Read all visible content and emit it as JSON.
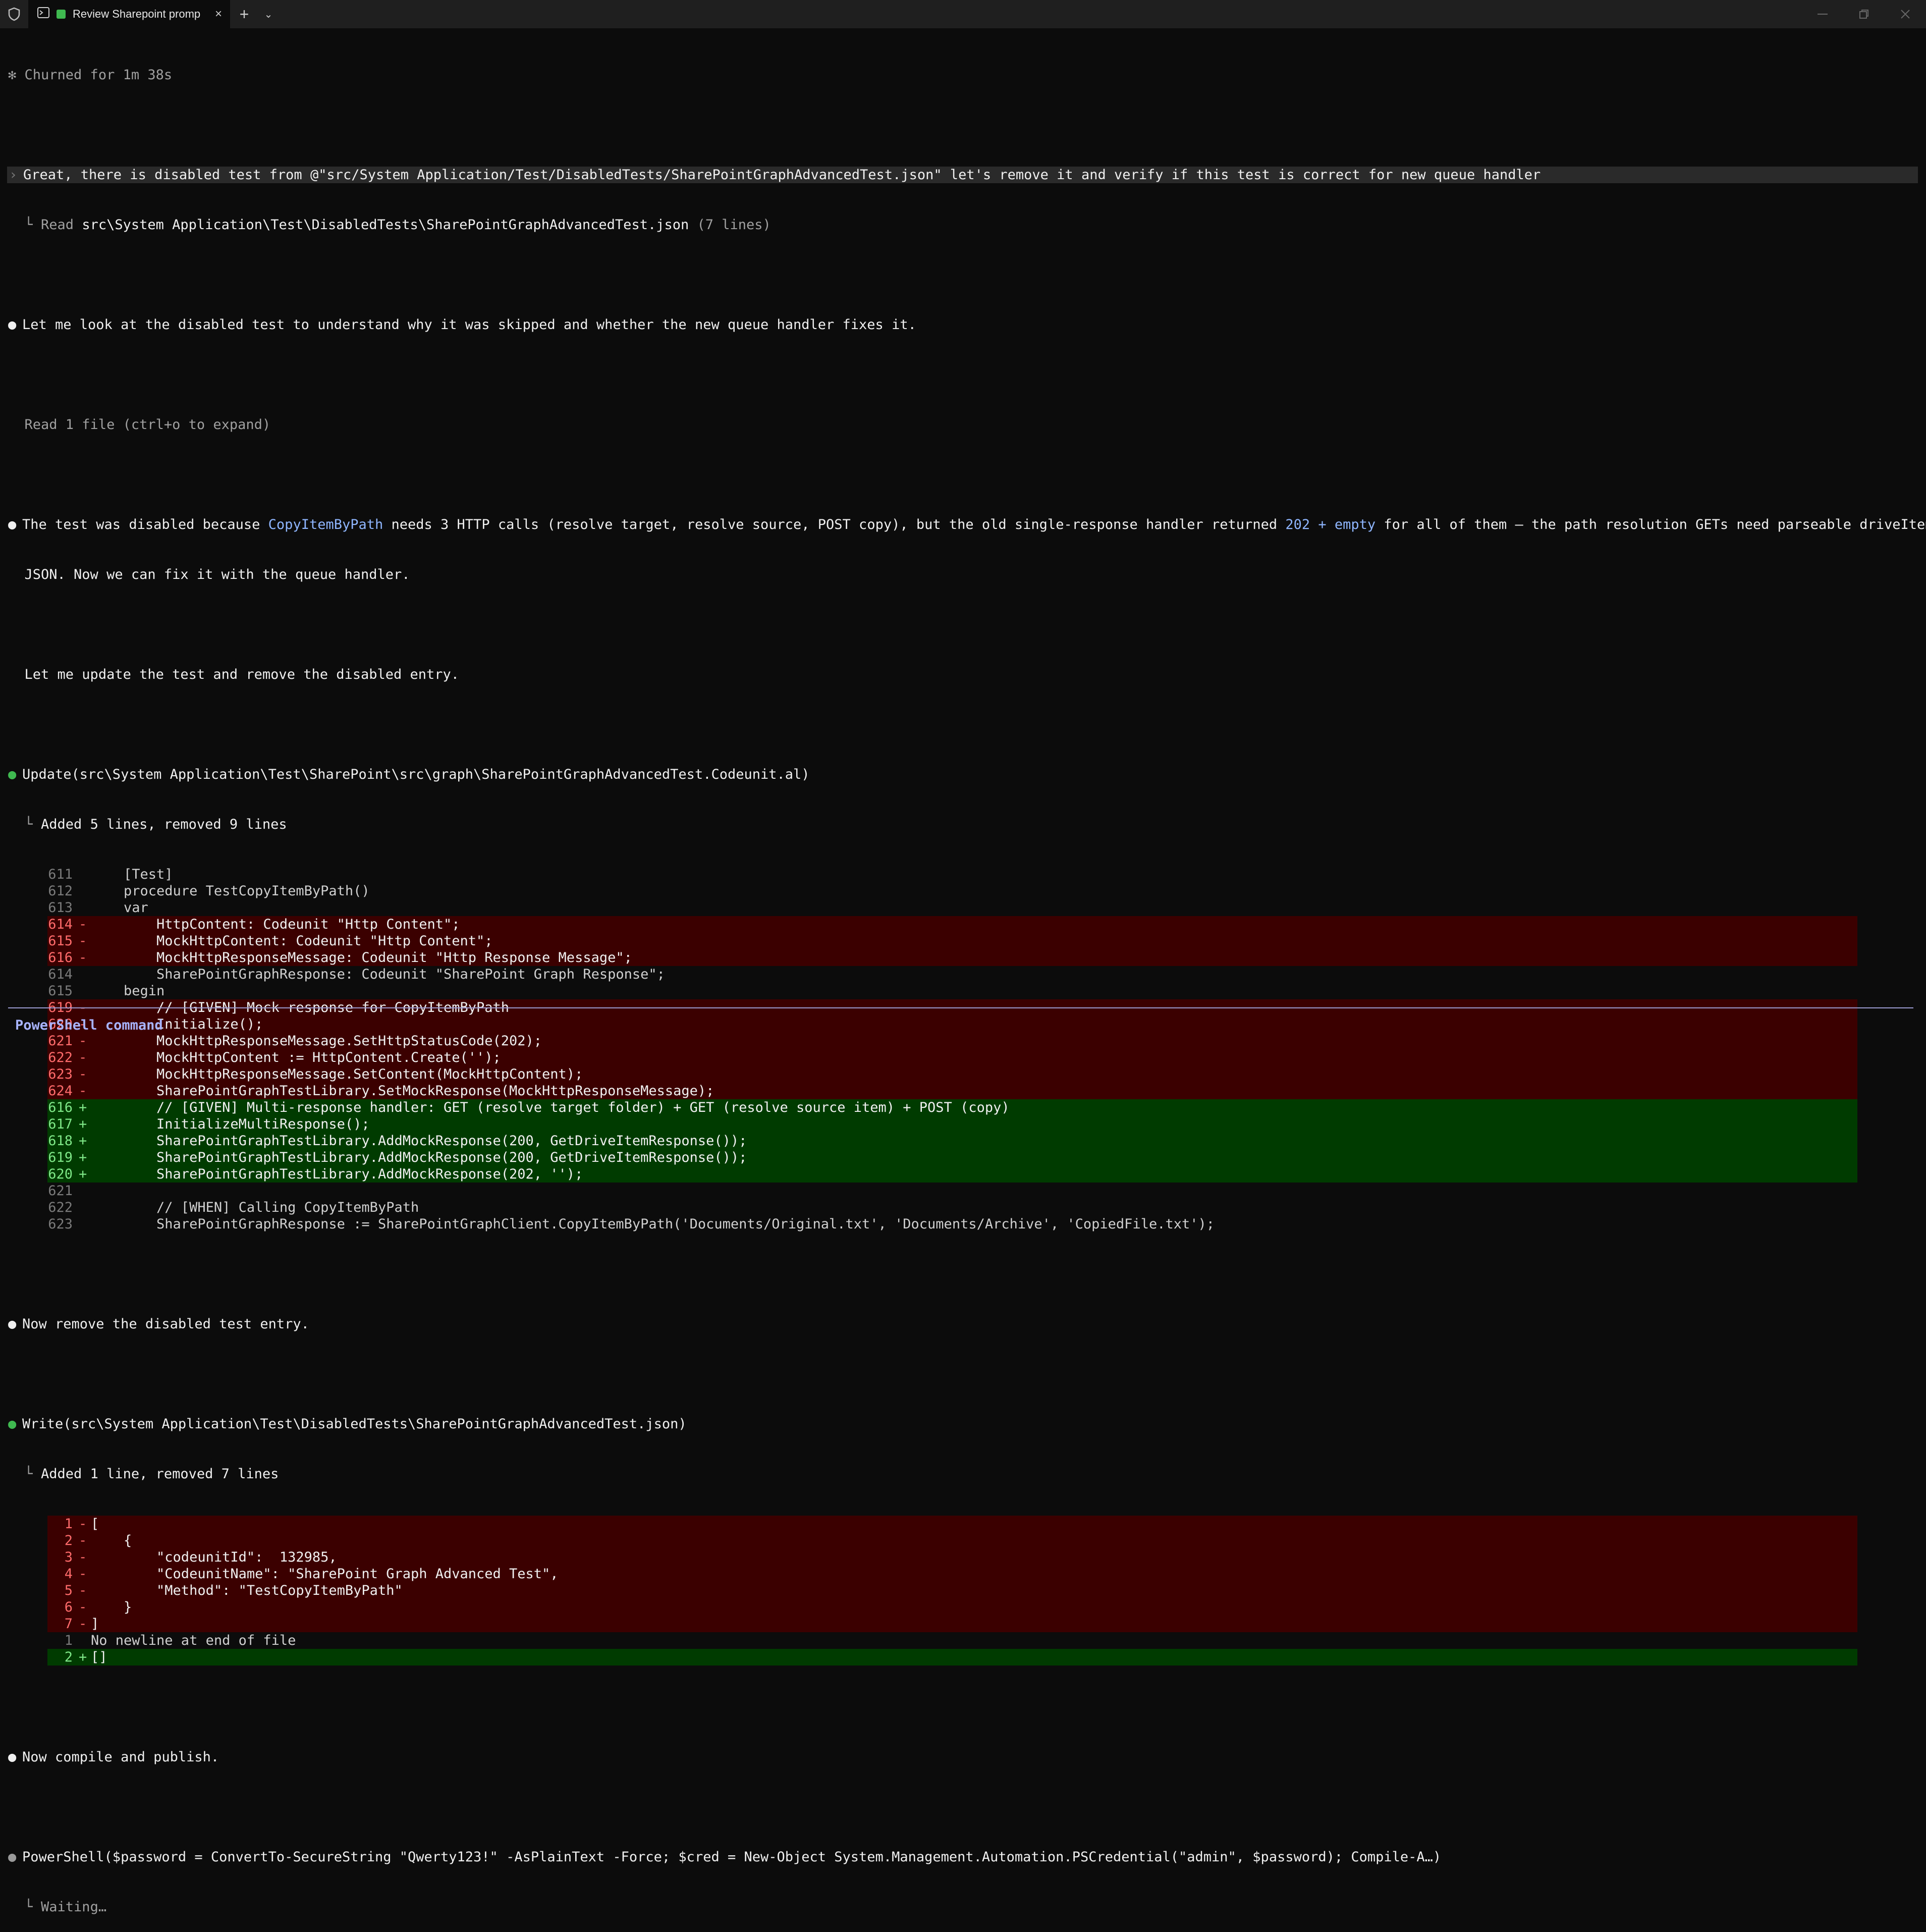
{
  "window": {
    "tab_title": "Review Sharepoint promp",
    "new_tab_symbol": "+",
    "dropdown_symbol": "⌄",
    "close_symbol": "×"
  },
  "status": {
    "churned": "Churned for 1m 38s"
  },
  "prompt": "Great, there is disabled test from @\"src/System Application/Test/DisabledTests/SharePointGraphAdvancedTest.json\" let's remove it and verify if this test is correct for new queue handler",
  "read_line": {
    "prefix": "Read",
    "path": "src\\System Application\\Test\\DisabledTests\\SharePointGraphAdvancedTest.json",
    "suffix": "(7 lines)"
  },
  "msg1": "Let me look at the disabled test to understand why it was skipped and whether the new queue handler fixes it.",
  "read_files": "Read 1 file (ctrl+o to expand)",
  "msg2": {
    "p1": "The test was disabled because ",
    "code1": "CopyItemByPath",
    "p2": " needs 3 HTTP calls (resolve target, resolve source, POST copy), but the old single-response handler returned ",
    "code2": "202 + empty",
    "p3": " for all of them — the path resolution GETs need parseable driveItem",
    "p4": "JSON. Now we can fix it with the queue handler."
  },
  "msg3": "Let me update the test and remove the disabled entry.",
  "update": {
    "header": "Update(src\\System Application\\Test\\SharePoint\\src\\graph\\SharePointGraphAdvancedTest.Codeunit.al)",
    "summary": "Added 5 lines, removed 9 lines",
    "lines": [
      {
        "type": "ctx",
        "num": "611",
        "sign": " ",
        "code": "    [Test]"
      },
      {
        "type": "ctx",
        "num": "612",
        "sign": " ",
        "code": "    procedure TestCopyItemByPath()"
      },
      {
        "type": "ctx",
        "num": "613",
        "sign": " ",
        "code": "    var"
      },
      {
        "type": "del",
        "num": "614",
        "sign": "-",
        "code": "        HttpContent: Codeunit \"Http Content\";"
      },
      {
        "type": "del",
        "num": "615",
        "sign": "-",
        "code": "        MockHttpContent: Codeunit \"Http Content\";"
      },
      {
        "type": "del",
        "num": "616",
        "sign": "-",
        "code": "        MockHttpResponseMessage: Codeunit \"Http Response Message\";"
      },
      {
        "type": "ctx",
        "num": "614",
        "sign": " ",
        "code": "        SharePointGraphResponse: Codeunit \"SharePoint Graph Response\";"
      },
      {
        "type": "ctx",
        "num": "615",
        "sign": " ",
        "code": "    begin"
      },
      {
        "type": "del",
        "num": "619",
        "sign": "-",
        "code": "        // [GIVEN] Mock response for CopyItemByPath"
      },
      {
        "type": "del",
        "num": "620",
        "sign": "-",
        "code": "        Initialize();"
      },
      {
        "type": "del",
        "num": "621",
        "sign": "-",
        "code": "        MockHttpResponseMessage.SetHttpStatusCode(202);"
      },
      {
        "type": "del",
        "num": "622",
        "sign": "-",
        "code": "        MockHttpContent := HttpContent.Create('');"
      },
      {
        "type": "del",
        "num": "623",
        "sign": "-",
        "code": "        MockHttpResponseMessage.SetContent(MockHttpContent);"
      },
      {
        "type": "del",
        "num": "624",
        "sign": "-",
        "code": "        SharePointGraphTestLibrary.SetMockResponse(MockHttpResponseMessage);"
      },
      {
        "type": "add",
        "num": "616",
        "sign": "+",
        "code": "        // [GIVEN] Multi-response handler: GET (resolve target folder) + GET (resolve source item) + POST (copy)"
      },
      {
        "type": "add",
        "num": "617",
        "sign": "+",
        "code": "        InitializeMultiResponse();"
      },
      {
        "type": "add",
        "num": "618",
        "sign": "+",
        "code": "        SharePointGraphTestLibrary.AddMockResponse(200, GetDriveItemResponse());"
      },
      {
        "type": "add",
        "num": "619",
        "sign": "+",
        "code": "        SharePointGraphTestLibrary.AddMockResponse(200, GetDriveItemResponse());"
      },
      {
        "type": "add",
        "num": "620",
        "sign": "+",
        "code": "        SharePointGraphTestLibrary.AddMockResponse(202, '');"
      },
      {
        "type": "ctx",
        "num": "621",
        "sign": " ",
        "code": ""
      },
      {
        "type": "ctx",
        "num": "622",
        "sign": " ",
        "code": "        // [WHEN] Calling CopyItemByPath"
      },
      {
        "type": "ctx",
        "num": "623",
        "sign": " ",
        "code": "        SharePointGraphResponse := SharePointGraphClient.CopyItemByPath('Documents/Original.txt', 'Documents/Archive', 'CopiedFile.txt');"
      }
    ]
  },
  "msg4": "Now remove the disabled test entry.",
  "write": {
    "header": "Write(src\\System Application\\Test\\DisabledTests\\SharePointGraphAdvancedTest.json)",
    "summary": "Added 1 line, removed 7 lines",
    "lines": [
      {
        "type": "del",
        "num": "1",
        "sign": "-",
        "code": "["
      },
      {
        "type": "del",
        "num": "2",
        "sign": "-",
        "code": "    {"
      },
      {
        "type": "del",
        "num": "3",
        "sign": "-",
        "code": "        \"codeunitId\":  132985,"
      },
      {
        "type": "del",
        "num": "4",
        "sign": "-",
        "code": "        \"CodeunitName\": \"SharePoint Graph Advanced Test\","
      },
      {
        "type": "del",
        "num": "5",
        "sign": "-",
        "code": "        \"Method\": \"TestCopyItemByPath\""
      },
      {
        "type": "del",
        "num": "6",
        "sign": "-",
        "code": "    }"
      },
      {
        "type": "del",
        "num": "7",
        "sign": "-",
        "code": "]"
      },
      {
        "type": "ctx",
        "num": "1",
        "sign": " ",
        "code": "No newline at end of file"
      },
      {
        "type": "add",
        "num": "2",
        "sign": "+",
        "code": "[]"
      }
    ]
  },
  "msg5": "Now compile and publish.",
  "powershell": {
    "header": "PowerShell($password = ConvertTo-SecureString \"Qwerty123!\" -AsPlainText -Force; $cred = New-Object System.Management.Automation.PSCredential(\"admin\", $password); Compile-A…)",
    "status": "Waiting…"
  },
  "footer": "PowerShell command"
}
